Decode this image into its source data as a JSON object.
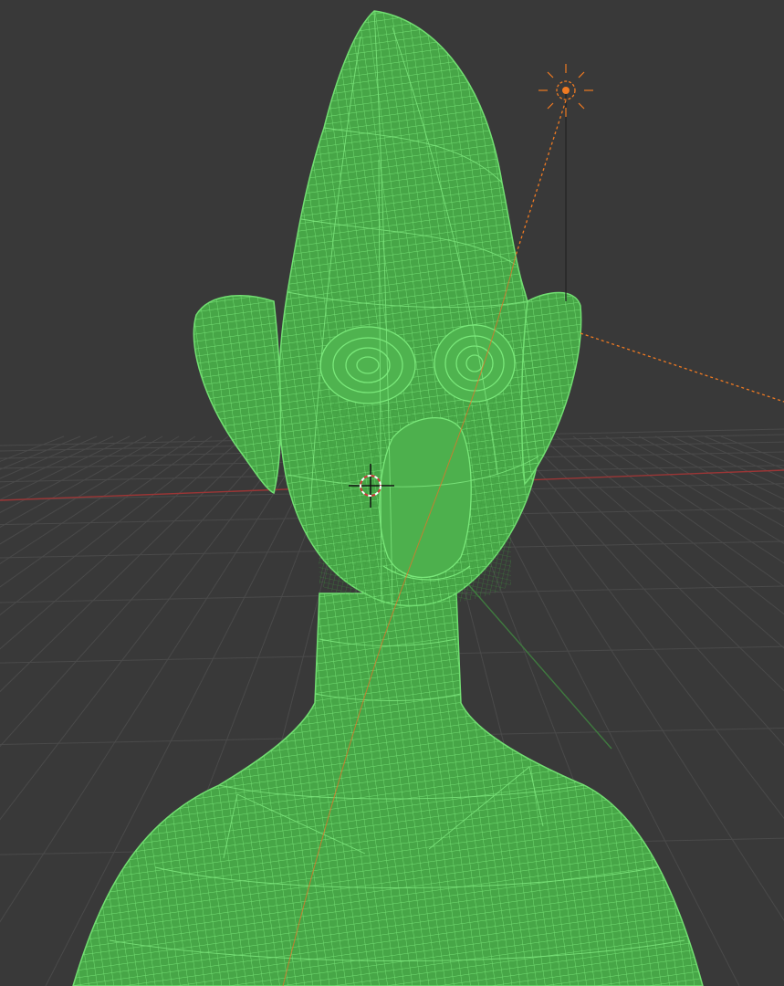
{
  "viewport": {
    "background": "#393939",
    "grid_color": "#4a4a4a",
    "x_axis_color": "#9b3636",
    "y_axis_color": "#3f7a3f",
    "mesh_fill": "#46a746",
    "mesh_line": "#6fe06f",
    "mesh_line_dense": "#3a8f3a",
    "light_color": "#f07a22",
    "cursor_color": "#e8e8e8",
    "cursor_accent": "#d23a3a"
  },
  "objects": {
    "mesh": {
      "icon": "wireframe-mesh-icon",
      "display": "wireframe"
    },
    "light": {
      "icon": "point-light-icon"
    },
    "cursor": {
      "icon": "3d-cursor-icon"
    }
  }
}
